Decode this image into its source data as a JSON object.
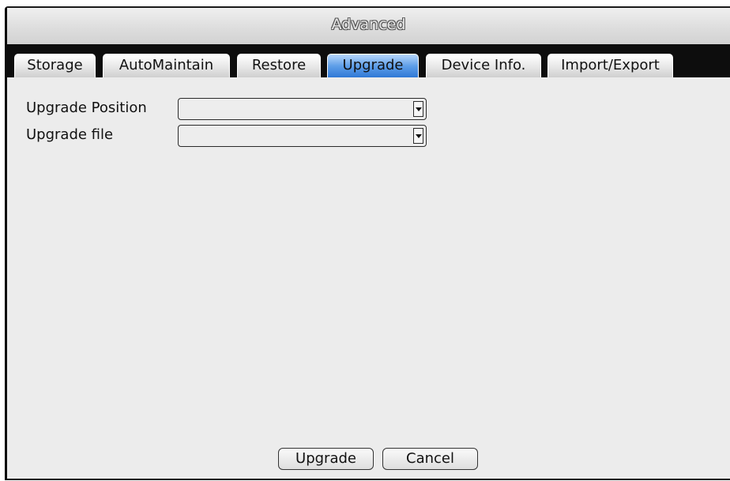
{
  "window": {
    "title": "Advanced"
  },
  "tabs": [
    {
      "label": "Storage",
      "active": false
    },
    {
      "label": "AutoMaintain",
      "active": false
    },
    {
      "label": "Restore",
      "active": false
    },
    {
      "label": "Upgrade",
      "active": true
    },
    {
      "label": "Device Info.",
      "active": false
    },
    {
      "label": "Import/Export",
      "active": false
    }
  ],
  "form": {
    "upgrade_position": {
      "label": "Upgrade Position",
      "value": ""
    },
    "upgrade_file": {
      "label": "Upgrade file",
      "value": ""
    }
  },
  "buttons": {
    "upgrade_label": "Upgrade",
    "cancel_label": "Cancel"
  },
  "colors": {
    "active_tab": "#4a8fe2",
    "tabbar_background": "#0d0d0d",
    "panel_background": "#ececec"
  }
}
